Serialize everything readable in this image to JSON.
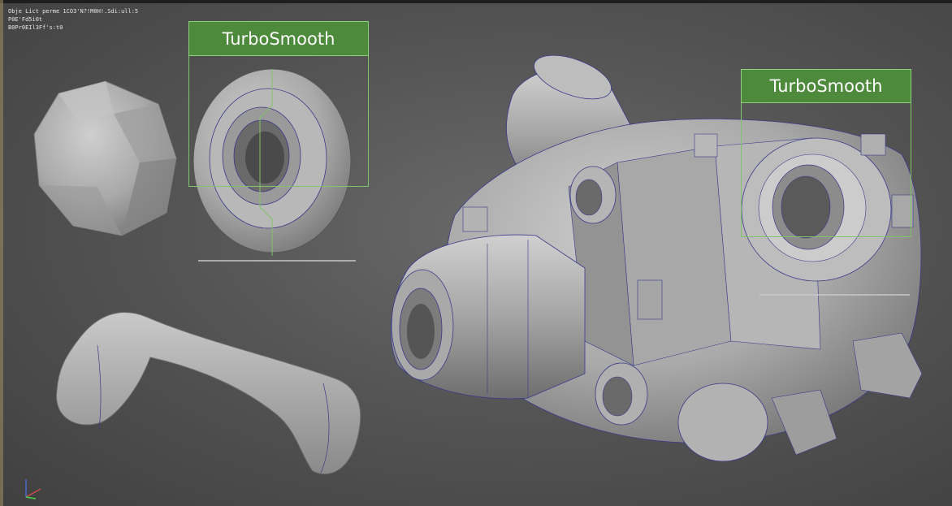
{
  "viewport": {
    "stats_lines": [
      "Obje Lict perme 1CO3'N?!M0H!.Sdi:ull:5",
      "P0E'Fd5i0t",
      "B0Pr0EIl3Ff's:t0"
    ],
    "modifier_labels": [
      "TurboSmooth",
      "TurboSmooth"
    ],
    "colors": {
      "background": "#5a5a5a",
      "label_fill": "#4e8a3c",
      "label_border": "#8fd07a",
      "wire": "#3a3a8a"
    }
  }
}
